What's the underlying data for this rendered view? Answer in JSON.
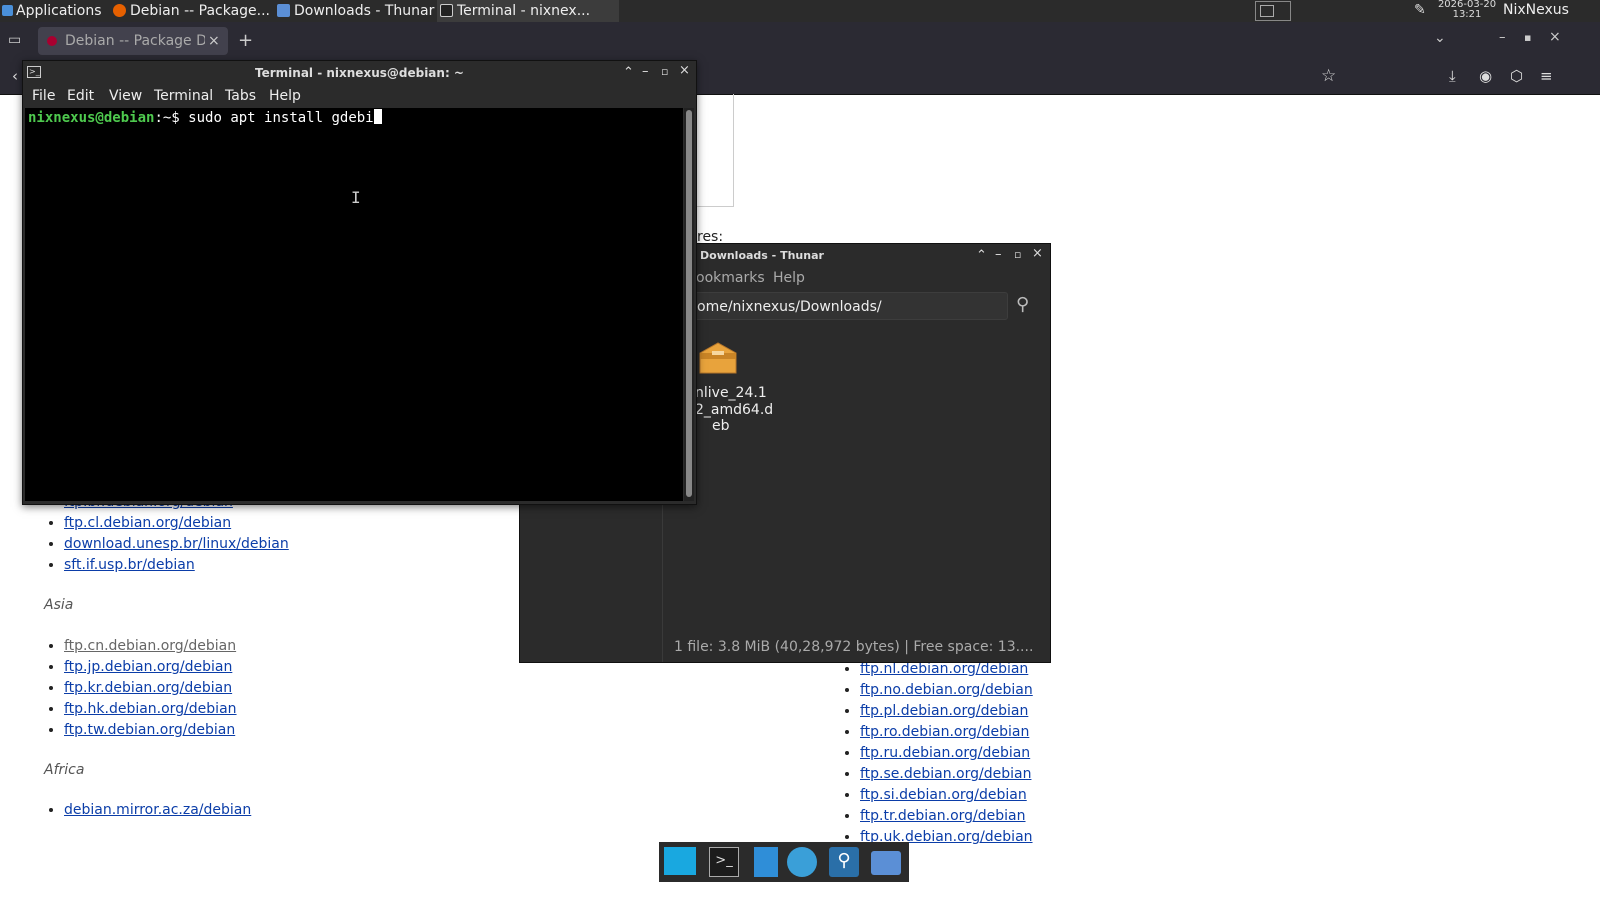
{
  "top_panel": {
    "applications_label": "Applications",
    "tasks": [
      "Debian -- Package...",
      "Downloads - Thunar",
      "Terminal - nixnex..."
    ],
    "clock_date": "2026-03-20",
    "clock_time": "13:21",
    "user": "NixNexus"
  },
  "browser": {
    "tab_title": "Debian -- Package Do",
    "new_tab_label": "+"
  },
  "webpage": {
    "partial_text": "res:",
    "list_sa": [
      "ftp.br.debian.org/debian",
      "ftp.cl.debian.org/debian",
      "download.unesp.br/linux/debian",
      "sft.if.usp.br/debian"
    ],
    "region_asia": "Asia",
    "list_asia": [
      "ftp.cn.debian.org/debian",
      "ftp.jp.debian.org/debian",
      "ftp.kr.debian.org/debian",
      "ftp.hk.debian.org/debian",
      "ftp.tw.debian.org/debian"
    ],
    "region_africa": "Africa",
    "list_africa": [
      "debian.mirror.ac.za/debian"
    ],
    "list_europe": [
      "ftp.nl.debian.org/debian",
      "ftp.no.debian.org/debian",
      "ftp.pl.debian.org/debian",
      "ftp.ro.debian.org/debian",
      "ftp.ru.debian.org/debian",
      "ftp.se.debian.org/debian",
      "ftp.si.debian.org/debian",
      "ftp.tr.debian.org/debian",
      "ftp.uk.debian.org/debian"
    ]
  },
  "terminal": {
    "title": "Terminal - nixnexus@debian: ~",
    "menu": [
      "File",
      "Edit",
      "View",
      "Terminal",
      "Tabs",
      "Help"
    ],
    "prompt_user": "nixnexus@debian",
    "prompt_sep": ":~$",
    "command": "sudo apt install gdebi"
  },
  "thunar": {
    "title": "Downloads - Thunar",
    "menu_visible": [
      "ookmarks",
      "Help"
    ],
    "path": "ome/nixnexus/Downloads/",
    "file_name_lines": [
      "nlive_24.1",
      "2_amd64.d",
      "eb"
    ],
    "status": "1 file: 3.8 MiB (40,28,972 bytes)  |  Free space: 13...."
  },
  "colors": {
    "prompt_green": "#4ec94e",
    "link_blue": "#0b3da8",
    "panel_bg": "#2b2b2b"
  }
}
